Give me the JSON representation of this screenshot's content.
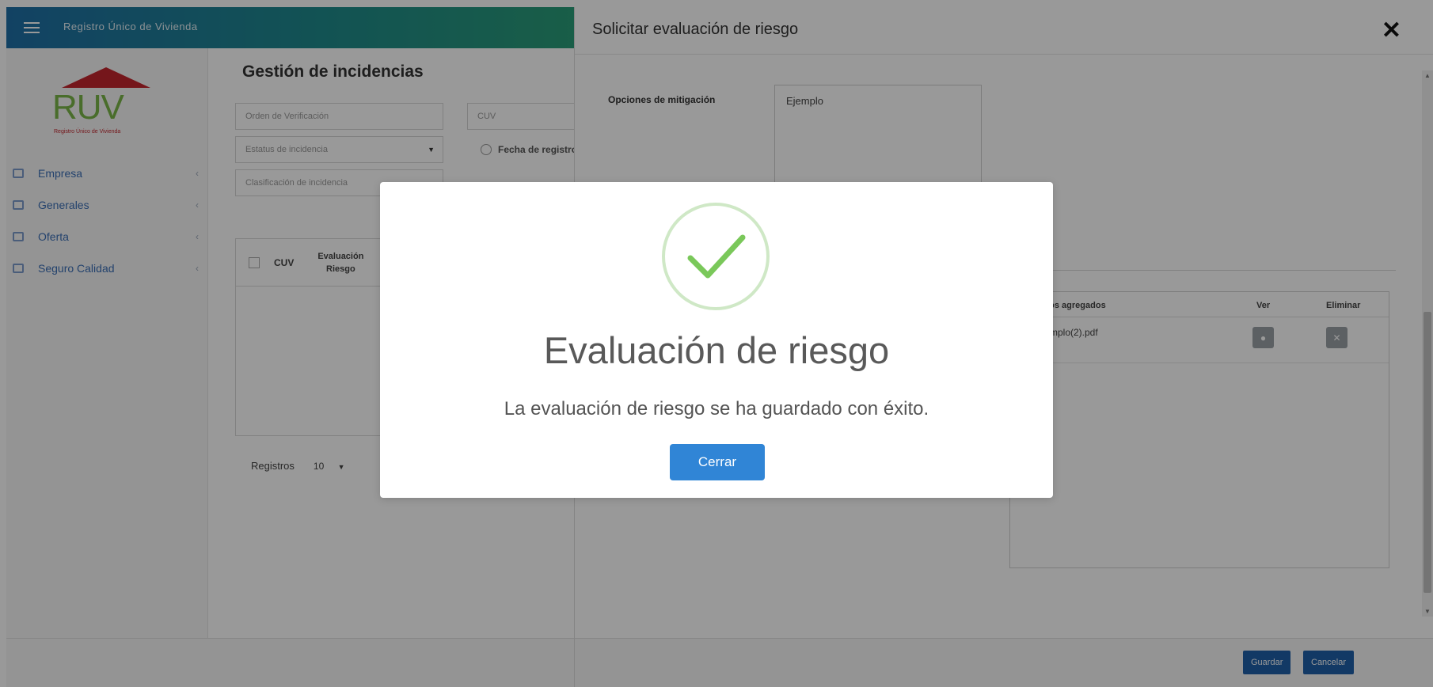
{
  "app": {
    "title": "Registro Único de Vivienda",
    "logo_text": "RUV",
    "logo_sub": "Registro Único de Vivienda"
  },
  "sidebar": {
    "items": [
      {
        "label": "Empresa",
        "icon": "building-icon"
      },
      {
        "label": "Generales",
        "icon": "grid-icon"
      },
      {
        "label": "Oferta",
        "icon": "home-icon"
      },
      {
        "label": "Seguro Calidad",
        "icon": "shield-icon"
      }
    ]
  },
  "main": {
    "page_title": "Gestión de incidencias",
    "filters": {
      "orden_placeholder": "Orden de Verificación",
      "cuv_placeholder": "CUV",
      "estatus_placeholder": "Estatus de incidencia",
      "fecha_label": "Fecha de registro",
      "clasificacion_placeholder": "Clasificación de incidencia"
    },
    "table": {
      "col_cuv": "CUV",
      "col_eval_line1": "Evaluación",
      "col_eval_line2": "Riesgo"
    },
    "pager": {
      "label": "Registros",
      "value": "10"
    }
  },
  "panel": {
    "title": "Solicitar evaluación de riesgo",
    "mitigacion_label": "Opciones de mitigación",
    "mitigacion_value": "Ejemplo",
    "files": {
      "col_archivos": "...os agregados",
      "col_ver": "Ver",
      "col_eliminar": "Eliminar",
      "rows": [
        {
          "name": "...mplo(2).pdf"
        }
      ]
    },
    "buttons": {
      "guardar": "Guardar",
      "cancelar": "Cancelar"
    }
  },
  "modal": {
    "title": "Evaluación de riesgo",
    "message": "La evaluación de riesgo se ha guardado con éxito.",
    "button": "Cerrar",
    "success_color": "#7ac85a",
    "button_color": "#3085d6"
  },
  "colors": {
    "topbar_start": "#1e6fa6",
    "topbar_end": "#2a9d78",
    "nav_link": "#3b6fb6",
    "primary_btn": "#1f5fa8"
  }
}
